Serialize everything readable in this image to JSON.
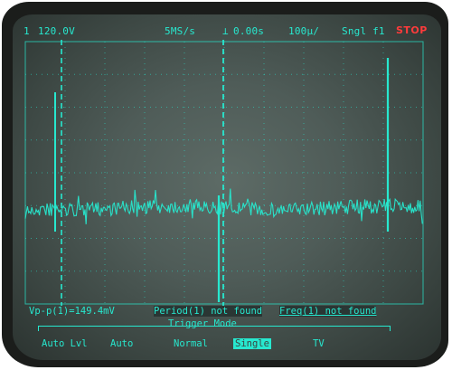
{
  "status_bar": {
    "channel": "1",
    "channel_scale": "120.0V",
    "sample_rate": "5MS/s",
    "time_position": "0.00s",
    "time_per_div": "100µ/",
    "trigger_info": "Sngl f1",
    "run_state": "STOP"
  },
  "measurements": {
    "vpp": "Vp-p(1)=149.4mV",
    "period": "Period(1) not found",
    "freq": "Freq(1) not found"
  },
  "trigger_menu": {
    "title": "Trigger Mode",
    "options": [
      "Auto Lvl",
      "Auto",
      "Normal",
      "Single",
      "TV"
    ],
    "selected": "Single"
  },
  "colors": {
    "trace": "#27e8cf",
    "stop": "#ff3b3b",
    "screen": "#4f5c58"
  }
}
